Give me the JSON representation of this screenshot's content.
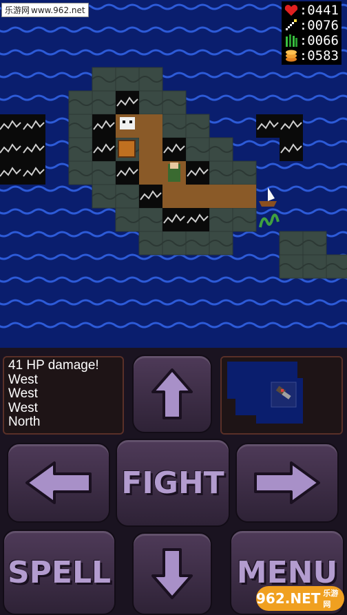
{
  "watermark": {
    "cn": "乐游网",
    "url": "www.962.net"
  },
  "stats": [
    {
      "icon": "heart-icon",
      "value": ":0441"
    },
    {
      "icon": "wand-icon",
      "value": ":0076"
    },
    {
      "icon": "grass-icon",
      "value": ":0066"
    },
    {
      "icon": "gold-icon",
      "value": ":0583"
    }
  ],
  "log": {
    "lines": [
      "41  HP damage!",
      "West",
      "West",
      "West",
      "North"
    ]
  },
  "buttons": {
    "up": "up-arrow",
    "down": "down-arrow",
    "left": "left-arrow",
    "right": "right-arrow",
    "fight_label": "FIGHT",
    "spell_label": "SPELL",
    "menu_label": "MENU"
  },
  "corner_watermark": {
    "brand": "962.NET",
    "cn": "乐游网"
  },
  "colors": {
    "ocean": "#0a1e6e",
    "wave": "#2d5bd8",
    "land": "#3a4a44",
    "mountain": "#0a0a0a",
    "path": "#8a5a28",
    "button_text": "#b39ccf"
  }
}
